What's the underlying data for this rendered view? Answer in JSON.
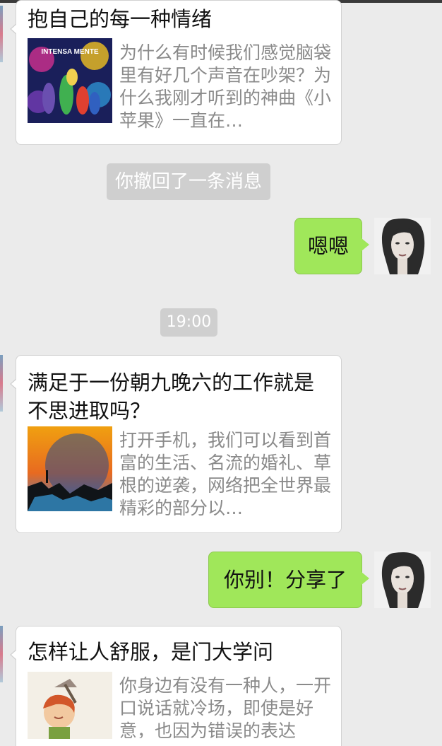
{
  "cards": [
    {
      "title": "抱自己的每一种情绪",
      "description": "为什么有时候我们感觉脑袋里有好几个声音在吵架？为什么我刚才听到的神曲《小苹果》一直在…",
      "thumb_caption": "INTENSA MENTE"
    },
    {
      "title": "满足于一份朝九晚六的工作就是不思进取吗？",
      "description": "打开手机，我们可以看到首富的生活、名流的婚礼、草根的逆袭，网络把全世界最精彩的部分以…"
    },
    {
      "title": "怎样让人舒服，是门大学问",
      "description": "你身边有没有一种人，一开口说话就冷场，即使是好意，也因为错误的表达"
    }
  ],
  "system": {
    "recalled": "你撤回了一条消息",
    "time": "19:00"
  },
  "outgoing": [
    {
      "text": "嗯嗯"
    },
    {
      "text": "你别！分享了"
    }
  ],
  "colors": {
    "background": "#ebebeb",
    "outgoing_bubble": "#a0e75a",
    "system_pill": "#cfcfcf"
  }
}
